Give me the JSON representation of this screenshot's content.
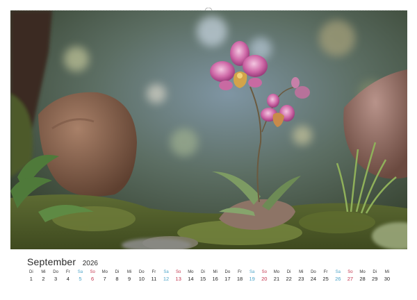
{
  "calendar": {
    "month": "September",
    "year": "2026",
    "days": [
      {
        "dow": "Di",
        "num": "1",
        "kind": "weekday"
      },
      {
        "dow": "Mi",
        "num": "2",
        "kind": "weekday"
      },
      {
        "dow": "Do",
        "num": "3",
        "kind": "weekday"
      },
      {
        "dow": "Fr",
        "num": "4",
        "kind": "weekday"
      },
      {
        "dow": "Sa",
        "num": "5",
        "kind": "sat"
      },
      {
        "dow": "So",
        "num": "6",
        "kind": "sun"
      },
      {
        "dow": "Mo",
        "num": "7",
        "kind": "weekday"
      },
      {
        "dow": "Di",
        "num": "8",
        "kind": "weekday"
      },
      {
        "dow": "Mi",
        "num": "9",
        "kind": "weekday"
      },
      {
        "dow": "Do",
        "num": "10",
        "kind": "weekday"
      },
      {
        "dow": "Fr",
        "num": "11",
        "kind": "weekday"
      },
      {
        "dow": "Sa",
        "num": "12",
        "kind": "sat"
      },
      {
        "dow": "So",
        "num": "13",
        "kind": "sun"
      },
      {
        "dow": "Mo",
        "num": "14",
        "kind": "weekday"
      },
      {
        "dow": "Di",
        "num": "15",
        "kind": "weekday"
      },
      {
        "dow": "Mi",
        "num": "16",
        "kind": "weekday"
      },
      {
        "dow": "Do",
        "num": "17",
        "kind": "weekday"
      },
      {
        "dow": "Fr",
        "num": "18",
        "kind": "weekday"
      },
      {
        "dow": "Sa",
        "num": "19",
        "kind": "sat"
      },
      {
        "dow": "So",
        "num": "20",
        "kind": "sun"
      },
      {
        "dow": "Mo",
        "num": "21",
        "kind": "weekday"
      },
      {
        "dow": "Di",
        "num": "22",
        "kind": "weekday"
      },
      {
        "dow": "Mi",
        "num": "23",
        "kind": "weekday"
      },
      {
        "dow": "Do",
        "num": "24",
        "kind": "weekday"
      },
      {
        "dow": "Fr",
        "num": "25",
        "kind": "weekday"
      },
      {
        "dow": "Sa",
        "num": "26",
        "kind": "sat"
      },
      {
        "dow": "So",
        "num": "27",
        "kind": "sun"
      },
      {
        "dow": "Mo",
        "num": "28",
        "kind": "weekday"
      },
      {
        "dow": "Di",
        "num": "29",
        "kind": "weekday"
      },
      {
        "dow": "Mi",
        "num": "30",
        "kind": "weekday"
      }
    ]
  },
  "colors": {
    "saturday": "#4aa3c7",
    "sunday": "#c2314a",
    "weekday": "#222222"
  },
  "photo": {
    "subject": "orchid-plant"
  }
}
